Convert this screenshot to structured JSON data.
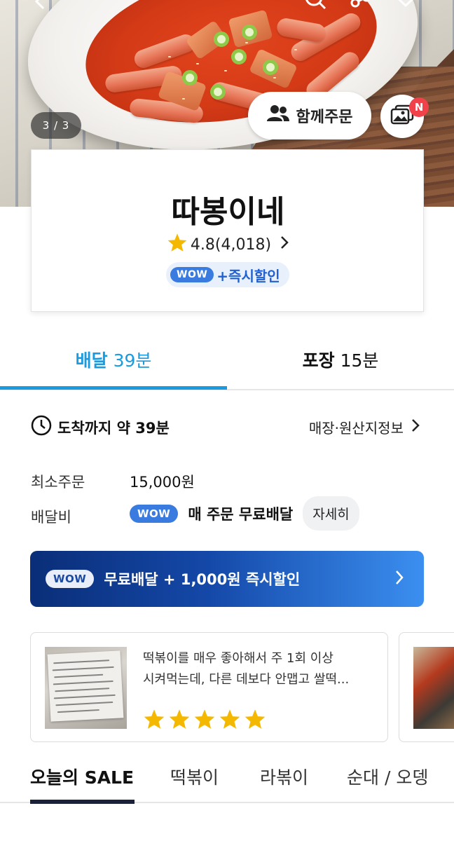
{
  "hero": {
    "page_indicator": "3 / 3",
    "group_order_label": "함께주문",
    "photo_badge": "N"
  },
  "store": {
    "name": "따봉이네",
    "rating": "4.8(4,018)",
    "wow_pill": "WOW",
    "wow_tag": "+즉시할인"
  },
  "tabs": {
    "delivery_label": "배달",
    "delivery_time": "39분",
    "pickup_label": "포장",
    "pickup_time": "15분"
  },
  "info": {
    "arrival": "도착까지 약 39분",
    "store_info_link": "매장·원산지정보",
    "min_order_label": "최소주문",
    "min_order_value": "15,000원",
    "delivery_fee_label": "배달비",
    "fee_wow": "WOW",
    "fee_text": "매 주문 무료배달",
    "detail_button": "자세히"
  },
  "banner": {
    "wow": "WOW",
    "text": "무료배달 + 1,000원 즉시할인"
  },
  "review": {
    "line1": "떡볶이를 매우 좋아해서 주 1회 이상",
    "line2": "시켜먹는데, 다른 데보다 안맵고 쌀떡...",
    "rating_stars": 5
  },
  "categories": [
    {
      "label": "오늘의 SALE",
      "active": true
    },
    {
      "label": "떡볶이",
      "active": false
    },
    {
      "label": "라볶이",
      "active": false
    },
    {
      "label": "순대 / 오뎅",
      "active": false
    }
  ],
  "colors": {
    "accent_blue": "#1a9be0",
    "wow_blue": "#3a7be0",
    "star_yellow": "#f5b800",
    "badge_red": "#f0424a"
  }
}
